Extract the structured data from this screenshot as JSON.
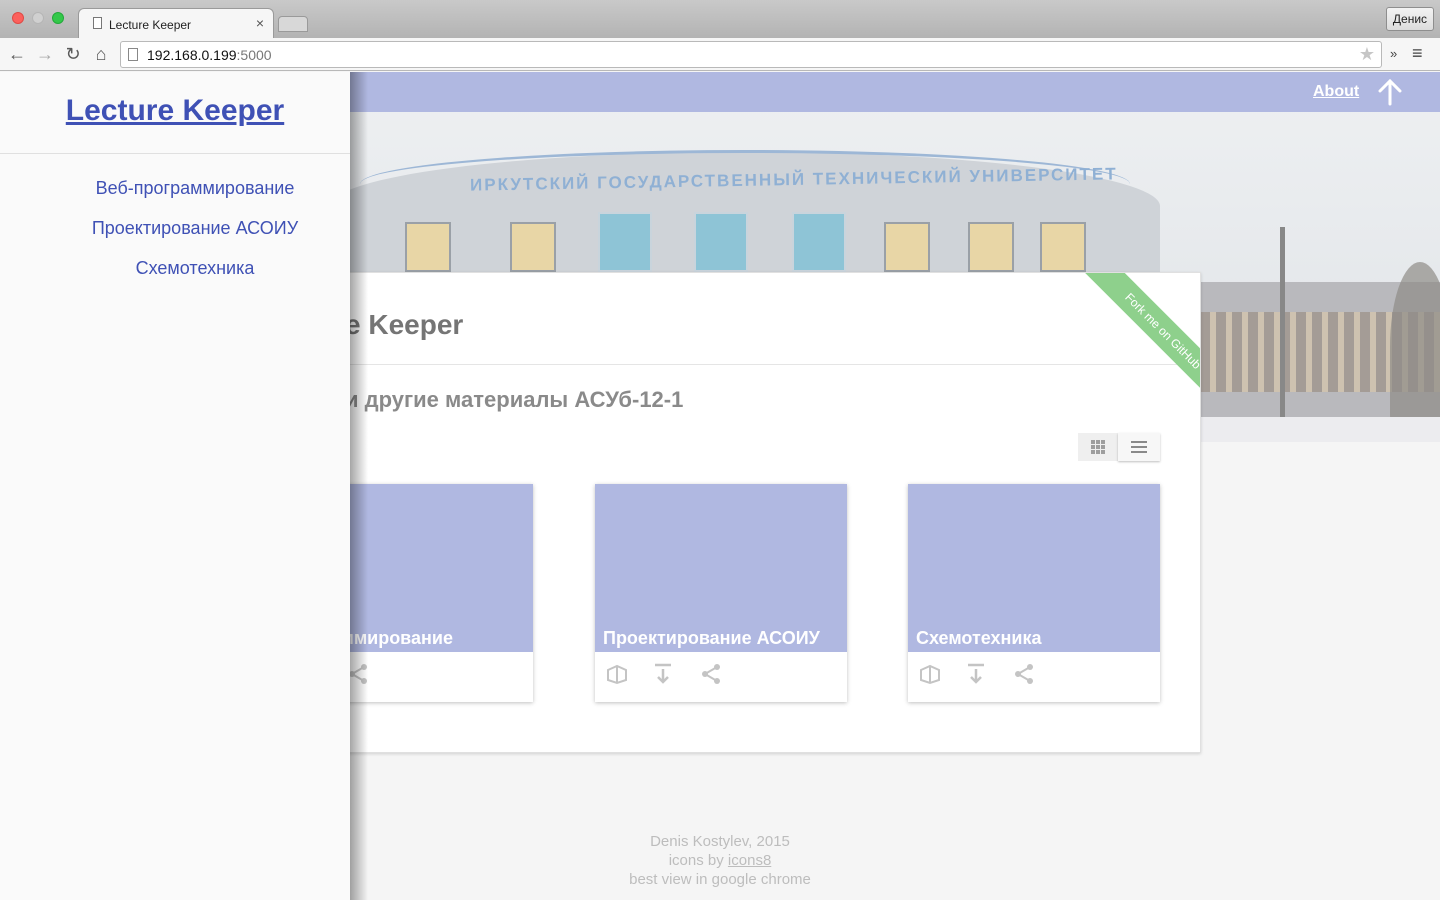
{
  "browser": {
    "tab_title": "Lecture Keeper",
    "tab_close": "×",
    "profile": "Денис",
    "url_host": "192.168.0.199",
    "url_port": ":5000",
    "back": "←",
    "forward": "→",
    "reload": "↻",
    "home": "⌂",
    "star": "★",
    "extensions": "»",
    "menu": "≡"
  },
  "topbar": {
    "about": "About"
  },
  "hero": {
    "sign": "ИРКУТСКИЙ ГОСУДАРСТВЕННЫЙ ТЕХНИЧЕСКИЙ УНИВЕРСИТЕТ"
  },
  "main": {
    "title_visible": "e Keeper",
    "subtitle_visible": "и другие материалы АСУб-12-1",
    "ribbon": "Fork me on GitHub",
    "cards": [
      {
        "label_visible": "ограммирование"
      },
      {
        "label": "Проектирование АСОИУ"
      },
      {
        "label": "Схемотехника"
      }
    ]
  },
  "drawer": {
    "title": "Lecture Keeper",
    "items": [
      "Веб-программирование",
      "Проектирование АСОИУ",
      "Схемотехника"
    ]
  },
  "footer": {
    "line1": "Denis Kostylev, 2015",
    "line2_prefix": "icons by ",
    "line2_link": "icons8",
    "line3": "best view in google chrome"
  },
  "colors": {
    "accent": "#b0b8e1",
    "brand": "#3f51b5",
    "ribbon": "#8ed08c"
  },
  "icons": [
    "up-arrow-icon",
    "grid-view-icon",
    "list-view-icon",
    "book-icon",
    "download-icon",
    "share-icon"
  ]
}
